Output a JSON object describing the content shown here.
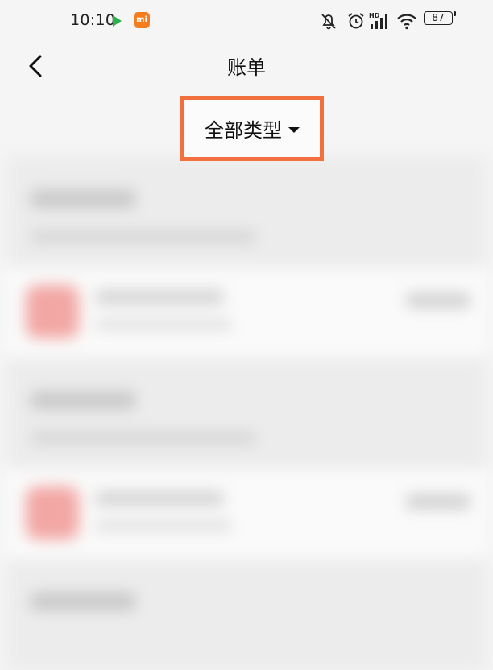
{
  "status_bar": {
    "time": "10:10",
    "mi_badge": "mi",
    "battery": "87",
    "icons": [
      "play-store-icon",
      "mi-app-icon",
      "mute-icon",
      "alarm-icon",
      "signal-hd-icon",
      "wifi-icon",
      "battery-icon"
    ],
    "colors": {
      "play": "#2bb24c",
      "mi": "#f57c1f"
    }
  },
  "header": {
    "title": "账单",
    "back_icon": "chevron-left-icon"
  },
  "filter": {
    "label": "全部类型",
    "caret_icon": "caret-down-icon",
    "highlight_color": "#f2703d"
  }
}
